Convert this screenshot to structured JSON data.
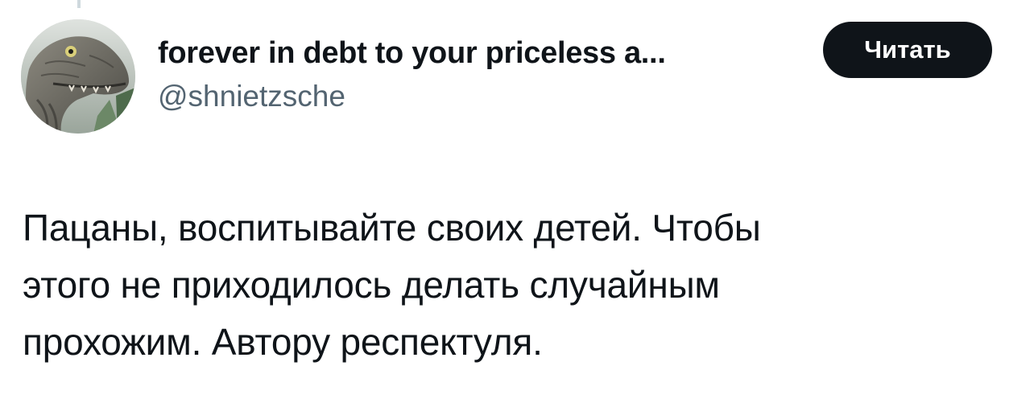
{
  "author": {
    "display_name": "forever in debt to your priceless a...",
    "handle": "@shnietzsche",
    "avatar_icon": "velociraptor-avatar-icon"
  },
  "subscribe_button": {
    "label": "Читать"
  },
  "tweet": {
    "text": "Пацаны, воспитывайте своих детей. Чтобы\nэтого не приходилось делать случайным\nпрохожим. Автору респектуля."
  },
  "colors": {
    "text_primary": "#0f1419",
    "text_secondary": "#536471",
    "button_bg": "#0f1419",
    "button_text": "#ffffff"
  }
}
